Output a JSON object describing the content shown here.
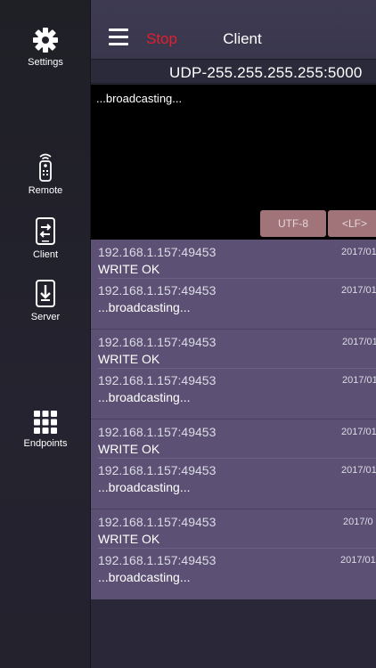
{
  "sidebar": {
    "items": [
      {
        "label": "Settings",
        "icon": "gear-icon"
      },
      {
        "label": "Remote",
        "icon": "remote-icon"
      },
      {
        "label": "Client",
        "icon": "client-icon"
      },
      {
        "label": "Server",
        "icon": "server-icon"
      },
      {
        "label": "Endpoints",
        "icon": "grid-icon"
      }
    ]
  },
  "header": {
    "stop_label": "Stop",
    "title": "Client",
    "stop_color": "#e0202f"
  },
  "endpoint": "UDP-255.255.255.255:5000",
  "console": {
    "text": "...broadcasting...",
    "encoding_label": "UTF-8",
    "line_ending_label": "<LF>"
  },
  "log": [
    {
      "entries": [
        {
          "address": "192.168.1.157:49453",
          "date": "2017/01",
          "message": "WRITE OK"
        },
        {
          "address": "192.168.1.157:49453",
          "date": "2017/01",
          "message": "...broadcasting..."
        }
      ]
    },
    {
      "entries": [
        {
          "address": "192.168.1.157:49453",
          "date": "2017/01",
          "message": "WRITE OK"
        },
        {
          "address": "192.168.1.157:49453",
          "date": "2017/01",
          "message": "...broadcasting..."
        }
      ]
    },
    {
      "entries": [
        {
          "address": "192.168.1.157:49453",
          "date": "2017/01",
          "message": "WRITE OK"
        },
        {
          "address": "192.168.1.157:49453",
          "date": "2017/01",
          "message": "...broadcasting..."
        }
      ]
    },
    {
      "entries": [
        {
          "address": "192.168.1.157:49453",
          "date": "2017/0",
          "message": "WRITE OK"
        },
        {
          "address": "192.168.1.157:49453",
          "date": "2017/01",
          "message": "...broadcasting..."
        }
      ]
    }
  ]
}
